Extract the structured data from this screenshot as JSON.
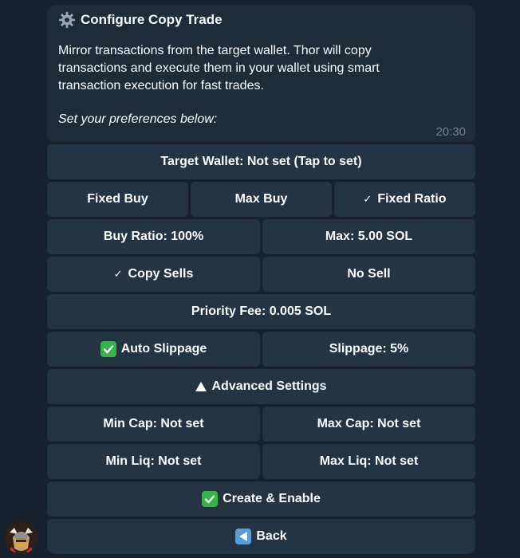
{
  "message": {
    "title": "Configure Copy Trade",
    "description": "Mirror transactions from the target wallet. Thor will copy transactions and execute them in your wallet using smart transaction execution for fast trades.",
    "prompt": "Set your preferences below:",
    "time": "20:30"
  },
  "keyboard": {
    "target_wallet": "Target Wallet: Not set (Tap to set)",
    "fixed_buy": "Fixed Buy",
    "max_buy": "Max Buy",
    "fixed_ratio": "Fixed Ratio",
    "buy_ratio": "Buy Ratio: 100%",
    "max_sol": "Max: 5.00 SOL",
    "copy_sells": "Copy Sells",
    "no_sell": "No Sell",
    "priority_fee": "Priority Fee: 0.005 SOL",
    "auto_slippage": "Auto Slippage",
    "slippage": "Slippage: 5%",
    "advanced_settings": "Advanced Settings",
    "min_cap": "Min Cap: Not set",
    "max_cap": "Max Cap: Not set",
    "min_liq": "Min Liq: Not set",
    "max_liq": "Max Liq: Not set",
    "create_enable": "Create & Enable",
    "back": "Back",
    "check_glyph": "✓"
  },
  "colors": {
    "background": "#19222c",
    "bubble": "#1f2c38",
    "button": "#253442",
    "time": "#6f8396",
    "check_green": "#37b34a",
    "back_blue": "#5a9bd8"
  },
  "icons": {
    "title": "gear-icon",
    "fixed_ratio": "checkmark-icon",
    "copy_sells": "checkmark-icon",
    "auto_slippage": "check-box-icon",
    "advanced_settings": "triangle-up-icon",
    "create_enable": "check-box-icon",
    "back": "back-arrow-icon",
    "bot": "bot-avatar"
  }
}
